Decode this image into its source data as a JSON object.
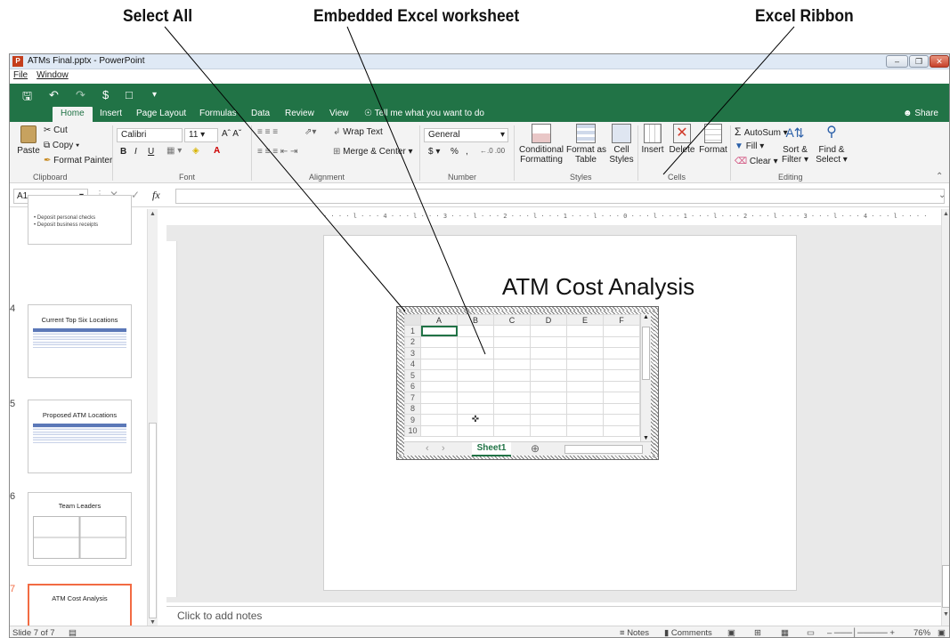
{
  "callouts": {
    "select_all": "Select All",
    "embedded": "Embedded Excel worksheet",
    "ribbon": "Excel Ribbon"
  },
  "window": {
    "title": "ATMs Final.pptx - PowerPoint",
    "menu": [
      "File",
      "Window"
    ]
  },
  "tabs": [
    "Home",
    "Insert",
    "Page Layout",
    "Formulas",
    "Data",
    "Review",
    "View"
  ],
  "tell_me": "Tell me what you want to do",
  "share": "Share",
  "clipboard": {
    "paste": "Paste",
    "cut": "Cut",
    "copy": "Copy",
    "format_painter": "Format Painter",
    "label": "Clipboard"
  },
  "font": {
    "name": "Calibri",
    "size": "11",
    "bold": "B",
    "italic": "I",
    "underline": "U",
    "label": "Font"
  },
  "alignment": {
    "wrap": "Wrap Text",
    "merge": "Merge & Center",
    "label": "Alignment"
  },
  "number": {
    "format": "General",
    "currency": "$",
    "percent": "%",
    "comma": ",",
    "label": "Number"
  },
  "styles": {
    "conditional": "Conditional",
    "formatting": "Formatting",
    "format_as": "Format as",
    "table": "Table",
    "cell": "Cell",
    "cell_styles": "Styles",
    "label": "Styles"
  },
  "cells": {
    "insert": "Insert",
    "delete": "Delete",
    "format": "Format",
    "label": "Cells"
  },
  "editing": {
    "autosum": "AutoSum",
    "fill": "Fill",
    "clear": "Clear",
    "sort1": "Sort &",
    "sort2": "Filter",
    "find1": "Find &",
    "find2": "Select",
    "label": "Editing"
  },
  "formula_bar": {
    "name_box": "A1",
    "fx": "fx"
  },
  "thumb_snippet": [
    "Deposit personal checks",
    "Deposit business receipts"
  ],
  "slides": [
    {
      "num": "4",
      "title": "Current Top Six Locations"
    },
    {
      "num": "5",
      "title": "Proposed ATM Locations"
    },
    {
      "num": "6",
      "title": "Team Leaders"
    },
    {
      "num": "7",
      "title": "ATM Cost Analysis"
    }
  ],
  "ruler_text": "· · · · l · · · 4 · · · l · · · 3 · · · l · · · 2 · · · l · · · 1 · · · l · · · 0 · · · l · · · 1 · · · l · · · 2 · · · l · · · 3 · · · l · · · 4 · · · l · · · ·",
  "slide_title": "ATM Cost Analysis",
  "sheet": {
    "columns": [
      "A",
      "B",
      "C",
      "D",
      "E",
      "F"
    ],
    "rows": [
      "1",
      "2",
      "3",
      "4",
      "5",
      "6",
      "7",
      "8",
      "9",
      "10"
    ],
    "tab": "Sheet1"
  },
  "notes_placeholder": "Click to add notes",
  "status": {
    "slide": "Slide 7 of 7",
    "notes": "Notes",
    "comments": "Comments",
    "zoom": "76%"
  },
  "colors": {
    "excel_green": "#217346",
    "slide7_border": "#f26b43"
  }
}
